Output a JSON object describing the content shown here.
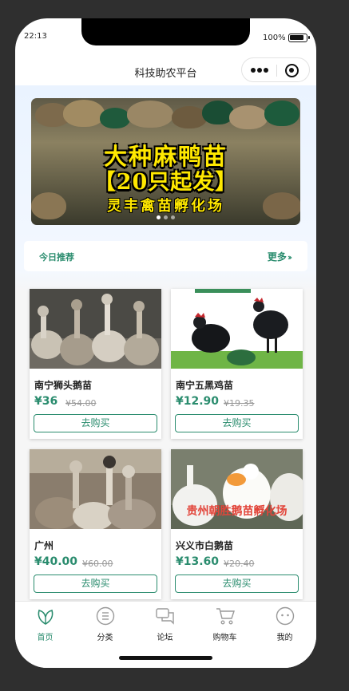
{
  "status": {
    "time": "22:13",
    "battery": "100%"
  },
  "nav": {
    "title": "科技助农平台"
  },
  "banner": {
    "line1": "大种麻鸭苗",
    "line2": "【20只起发】",
    "line3": "灵丰禽苗孵化场"
  },
  "recommend": {
    "title": "今日推荐",
    "more": "更多"
  },
  "products": [
    {
      "name": "南宁狮头鹅苗",
      "price": "¥36",
      "original": "¥54.00",
      "buy": "去购买"
    },
    {
      "name": "南宁五黑鸡苗",
      "price": "¥12.90",
      "original": "¥19.35",
      "buy": "去购买"
    },
    {
      "name": "广州",
      "price": "¥40.00",
      "original": "¥60.00",
      "buy": "去购买"
    },
    {
      "name": "兴义市白鹅苗",
      "price": "¥13.60",
      "original": "¥20.40",
      "buy": "去购买",
      "image_text": "贵州朝胜鹅苗孵化场"
    }
  ],
  "tabs": [
    {
      "label": "首页",
      "icon": "home-leaf-icon"
    },
    {
      "label": "分类",
      "icon": "category-icon"
    },
    {
      "label": "论坛",
      "icon": "forum-icon"
    },
    {
      "label": "购物车",
      "icon": "cart-icon"
    },
    {
      "label": "我的",
      "icon": "profile-icon"
    }
  ],
  "colors": {
    "accent": "#2a8c6e",
    "price": "#2a8c6e",
    "watermark": "#e2453a"
  }
}
